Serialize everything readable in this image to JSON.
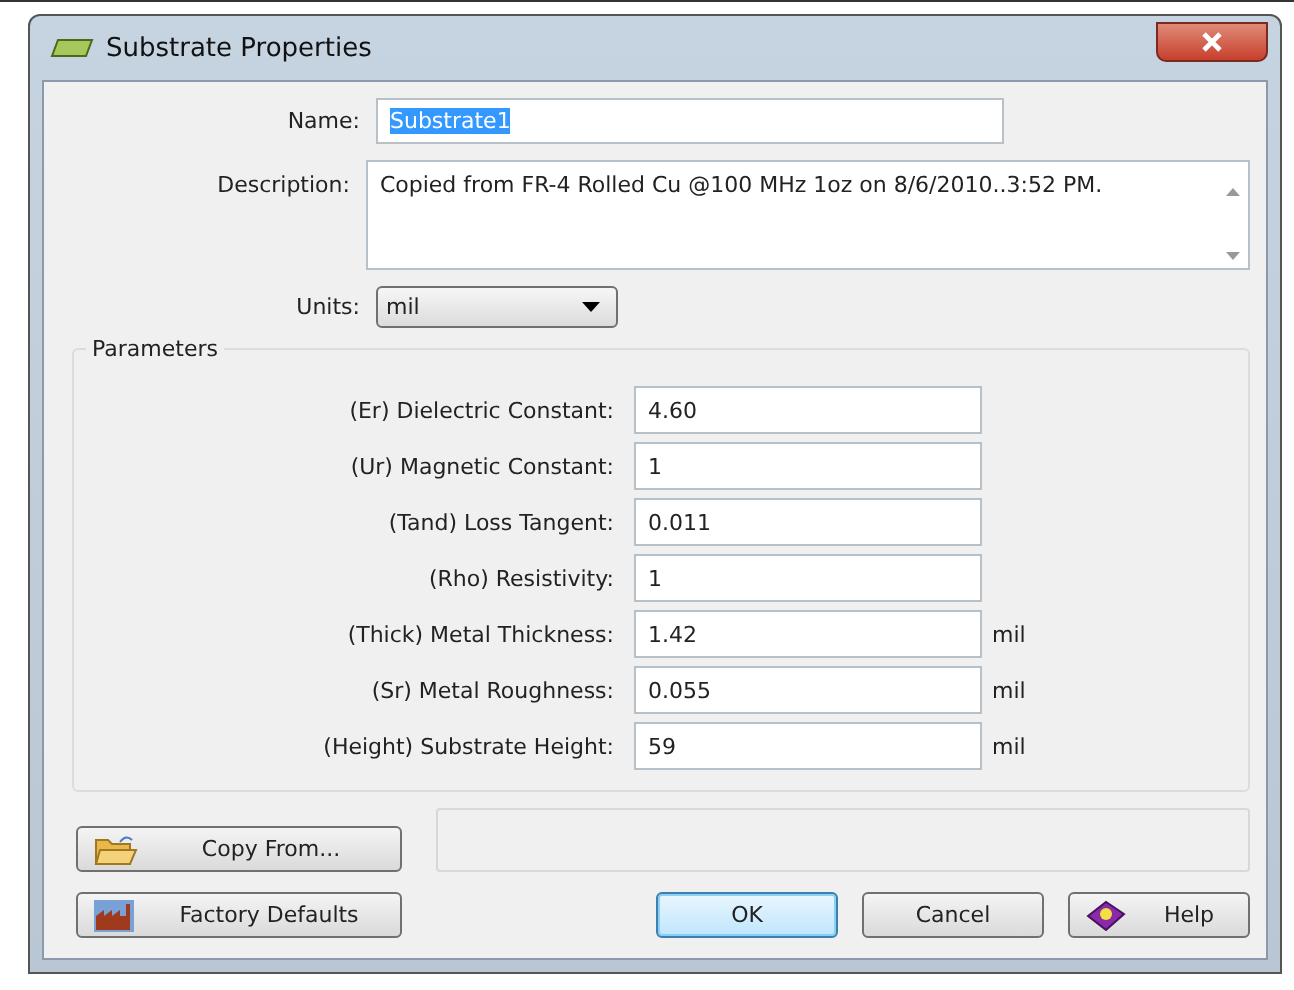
{
  "window": {
    "title": "Substrate Properties"
  },
  "name": {
    "label": "Name:",
    "value": "Substrate1",
    "selected": true
  },
  "description": {
    "label": "Description:",
    "value": "Copied from FR-4 Rolled Cu @100 MHz 1oz on 8/6/2010..3:52 PM."
  },
  "units": {
    "label": "Units:",
    "value": "mil"
  },
  "parameters": {
    "title": "Parameters",
    "rows": [
      {
        "label": "(Er) Dielectric Constant:",
        "value": "4.60"
      },
      {
        "label": "(Ur) Magnetic Constant:",
        "value": "1"
      },
      {
        "label": "(Tand) Loss Tangent:",
        "value": "0.011"
      },
      {
        "label": "(Rho) Resistivity:",
        "value": "1"
      },
      {
        "label": "(Thick) Metal Thickness:",
        "value": "1.42",
        "unit": "mil"
      },
      {
        "label": "(Sr) Metal Roughness:",
        "value": "0.055",
        "unit": "mil"
      },
      {
        "label": "(Height) Substrate Height:",
        "value": "59",
        "unit": "mil"
      }
    ]
  },
  "buttons": {
    "copy_from": "Copy From...",
    "factory_defaults": "Factory Defaults",
    "ok": "OK",
    "cancel": "Cancel",
    "help": "Help"
  }
}
